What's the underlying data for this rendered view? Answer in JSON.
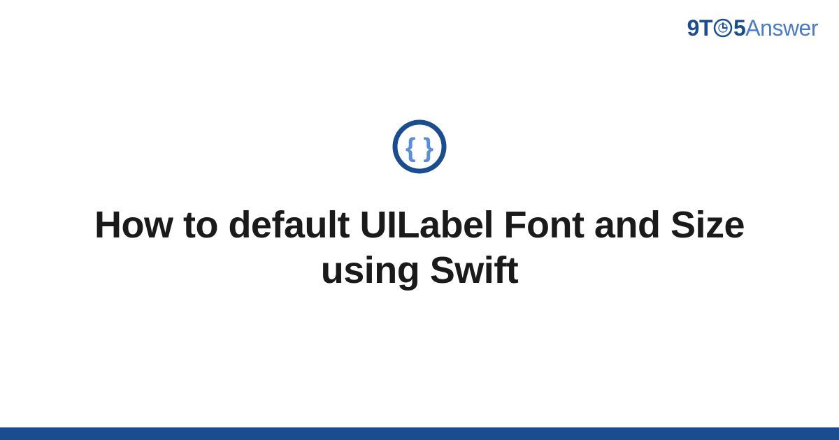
{
  "logo": {
    "part1": "9T",
    "part2": "5",
    "part3": "Answer"
  },
  "main": {
    "title": "How to default UILabel Font and Size using Swift"
  },
  "colors": {
    "primary": "#1a4d8f",
    "accent": "#4a7bc4",
    "text": "#1a1a1a"
  }
}
